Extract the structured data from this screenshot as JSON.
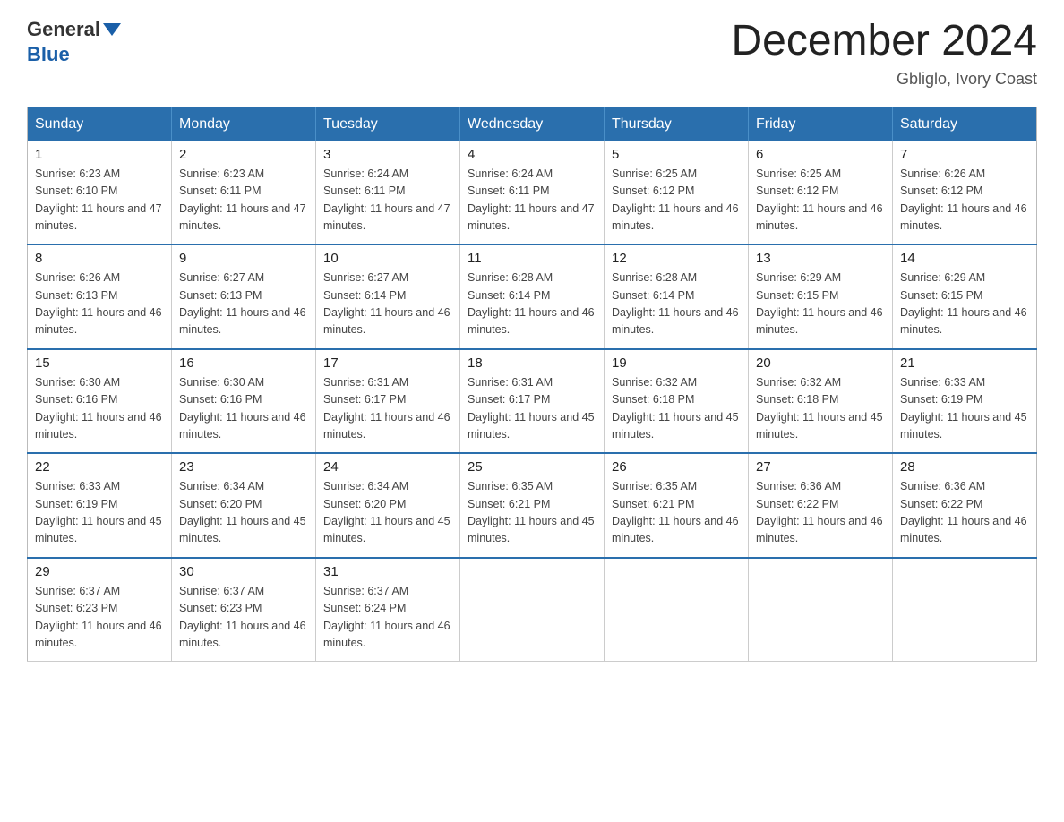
{
  "logo": {
    "general": "General",
    "blue": "Blue"
  },
  "header": {
    "month_title": "December 2024",
    "location": "Gbliglo, Ivory Coast"
  },
  "weekdays": [
    "Sunday",
    "Monday",
    "Tuesday",
    "Wednesday",
    "Thursday",
    "Friday",
    "Saturday"
  ],
  "weeks": [
    [
      {
        "day": "1",
        "sunrise": "6:23 AM",
        "sunset": "6:10 PM",
        "daylight": "11 hours and 47 minutes."
      },
      {
        "day": "2",
        "sunrise": "6:23 AM",
        "sunset": "6:11 PM",
        "daylight": "11 hours and 47 minutes."
      },
      {
        "day": "3",
        "sunrise": "6:24 AM",
        "sunset": "6:11 PM",
        "daylight": "11 hours and 47 minutes."
      },
      {
        "day": "4",
        "sunrise": "6:24 AM",
        "sunset": "6:11 PM",
        "daylight": "11 hours and 47 minutes."
      },
      {
        "day": "5",
        "sunrise": "6:25 AM",
        "sunset": "6:12 PM",
        "daylight": "11 hours and 46 minutes."
      },
      {
        "day": "6",
        "sunrise": "6:25 AM",
        "sunset": "6:12 PM",
        "daylight": "11 hours and 46 minutes."
      },
      {
        "day": "7",
        "sunrise": "6:26 AM",
        "sunset": "6:12 PM",
        "daylight": "11 hours and 46 minutes."
      }
    ],
    [
      {
        "day": "8",
        "sunrise": "6:26 AM",
        "sunset": "6:13 PM",
        "daylight": "11 hours and 46 minutes."
      },
      {
        "day": "9",
        "sunrise": "6:27 AM",
        "sunset": "6:13 PM",
        "daylight": "11 hours and 46 minutes."
      },
      {
        "day": "10",
        "sunrise": "6:27 AM",
        "sunset": "6:14 PM",
        "daylight": "11 hours and 46 minutes."
      },
      {
        "day": "11",
        "sunrise": "6:28 AM",
        "sunset": "6:14 PM",
        "daylight": "11 hours and 46 minutes."
      },
      {
        "day": "12",
        "sunrise": "6:28 AM",
        "sunset": "6:14 PM",
        "daylight": "11 hours and 46 minutes."
      },
      {
        "day": "13",
        "sunrise": "6:29 AM",
        "sunset": "6:15 PM",
        "daylight": "11 hours and 46 minutes."
      },
      {
        "day": "14",
        "sunrise": "6:29 AM",
        "sunset": "6:15 PM",
        "daylight": "11 hours and 46 minutes."
      }
    ],
    [
      {
        "day": "15",
        "sunrise": "6:30 AM",
        "sunset": "6:16 PM",
        "daylight": "11 hours and 46 minutes."
      },
      {
        "day": "16",
        "sunrise": "6:30 AM",
        "sunset": "6:16 PM",
        "daylight": "11 hours and 46 minutes."
      },
      {
        "day": "17",
        "sunrise": "6:31 AM",
        "sunset": "6:17 PM",
        "daylight": "11 hours and 46 minutes."
      },
      {
        "day": "18",
        "sunrise": "6:31 AM",
        "sunset": "6:17 PM",
        "daylight": "11 hours and 45 minutes."
      },
      {
        "day": "19",
        "sunrise": "6:32 AM",
        "sunset": "6:18 PM",
        "daylight": "11 hours and 45 minutes."
      },
      {
        "day": "20",
        "sunrise": "6:32 AM",
        "sunset": "6:18 PM",
        "daylight": "11 hours and 45 minutes."
      },
      {
        "day": "21",
        "sunrise": "6:33 AM",
        "sunset": "6:19 PM",
        "daylight": "11 hours and 45 minutes."
      }
    ],
    [
      {
        "day": "22",
        "sunrise": "6:33 AM",
        "sunset": "6:19 PM",
        "daylight": "11 hours and 45 minutes."
      },
      {
        "day": "23",
        "sunrise": "6:34 AM",
        "sunset": "6:20 PM",
        "daylight": "11 hours and 45 minutes."
      },
      {
        "day": "24",
        "sunrise": "6:34 AM",
        "sunset": "6:20 PM",
        "daylight": "11 hours and 45 minutes."
      },
      {
        "day": "25",
        "sunrise": "6:35 AM",
        "sunset": "6:21 PM",
        "daylight": "11 hours and 45 minutes."
      },
      {
        "day": "26",
        "sunrise": "6:35 AM",
        "sunset": "6:21 PM",
        "daylight": "11 hours and 46 minutes."
      },
      {
        "day": "27",
        "sunrise": "6:36 AM",
        "sunset": "6:22 PM",
        "daylight": "11 hours and 46 minutes."
      },
      {
        "day": "28",
        "sunrise": "6:36 AM",
        "sunset": "6:22 PM",
        "daylight": "11 hours and 46 minutes."
      }
    ],
    [
      {
        "day": "29",
        "sunrise": "6:37 AM",
        "sunset": "6:23 PM",
        "daylight": "11 hours and 46 minutes."
      },
      {
        "day": "30",
        "sunrise": "6:37 AM",
        "sunset": "6:23 PM",
        "daylight": "11 hours and 46 minutes."
      },
      {
        "day": "31",
        "sunrise": "6:37 AM",
        "sunset": "6:24 PM",
        "daylight": "11 hours and 46 minutes."
      },
      null,
      null,
      null,
      null
    ]
  ]
}
